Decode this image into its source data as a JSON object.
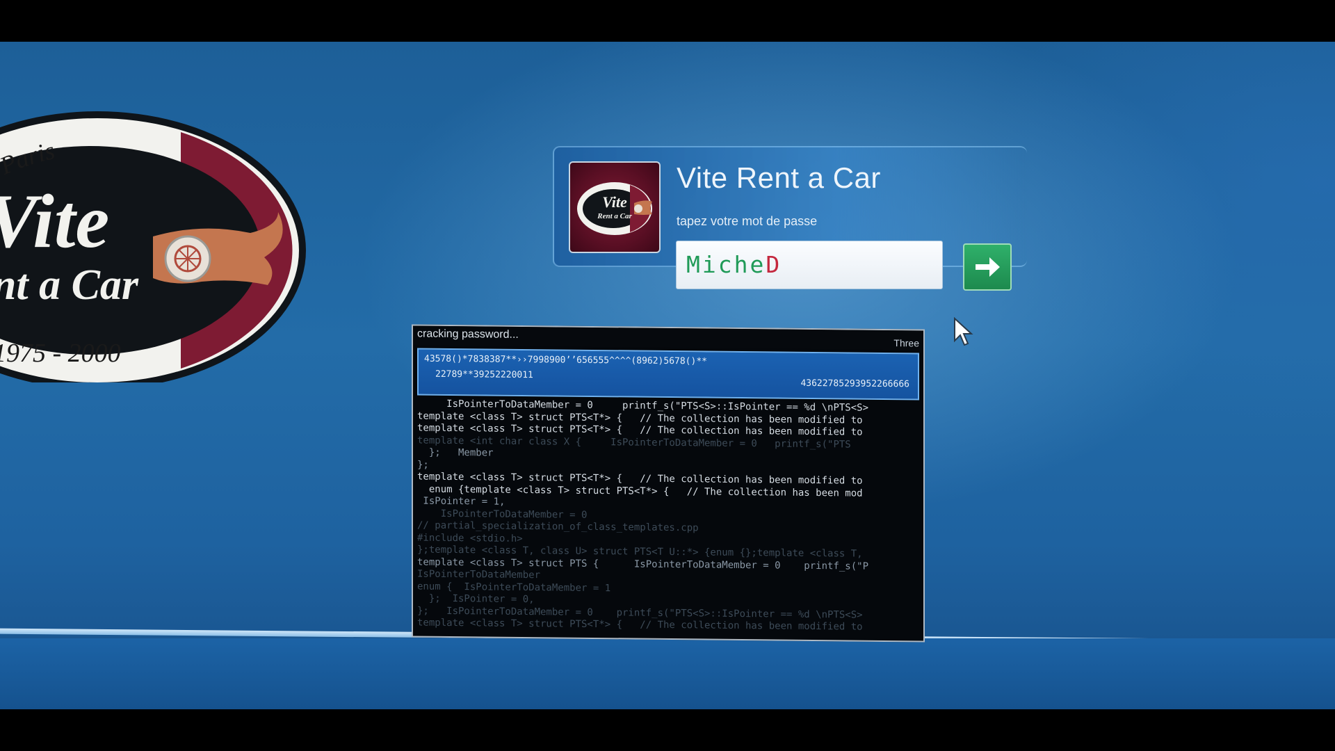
{
  "brand": {
    "name": "Vite Rent a Car",
    "big_logo": {
      "top_arc": "France - Paris",
      "word1": "Vite",
      "word2": "Rent a Car",
      "years": "1975 - 2000"
    },
    "small_logo": {
      "word1": "Vite",
      "word2": "Rent a Car"
    }
  },
  "login": {
    "title": "Vite Rent a Car",
    "prompt": "tapez votre mot de passe",
    "password_value_confirmed": "Miche",
    "password_value_current_char": "D",
    "submit_icon": "arrow-right-icon"
  },
  "cracker": {
    "title": "cracking password...",
    "mode": "Three",
    "output_line1": "43578()*7838387**››7998900’’656555^^^^(8962)5678()**",
    "output_line2": "22789**39252220011",
    "output_line3": "43622785293952266666",
    "code_lines": [
      {
        "text": "     IsPointerToDataMember = 0     printf_s(\"PTS<S>::IsPointer == %d \\nPTS<S>",
        "style": "bright"
      },
      {
        "text": "template <class T> struct PTS<T*> {   // The collection has been modified to",
        "style": "bright"
      },
      {
        "text": "template <class T> struct PTS<T*> {   // The collection has been modified to",
        "style": "bright"
      },
      {
        "text": "template <int char class X {     IsPointerToDataMember = 0   printf_s(\"PTS",
        "style": "dim"
      },
      {
        "text": "  };   Member",
        "style": "mid"
      },
      {
        "text": "};",
        "style": "mid"
      },
      {
        "text": "template <class T> struct PTS<T*> {   // The collection has been modified to",
        "style": "bright"
      },
      {
        "text": "  enum {template <class T> struct PTS<T*> {   // The collection has been mod",
        "style": "bright"
      },
      {
        "text": " IsPointer = 1,",
        "style": "mid"
      },
      {
        "text": "    IsPointerToDataMember = 0",
        "style": "dim"
      },
      {
        "text": "// partial_specialization_of_class_templates.cpp",
        "style": "dim"
      },
      {
        "text": "#include <stdio.h>",
        "style": "dim"
      },
      {
        "text": "};template <class T, class U> struct PTS<T U::*> {enum {};template <class T,",
        "style": "dim"
      },
      {
        "text": "template <class T> struct PTS {      IsPointerToDataMember = 0    printf_s(\"P",
        "style": "mid"
      },
      {
        "text": "IsPointerToDataMember",
        "style": "dim"
      },
      {
        "text": "enum {  IsPointerToDataMember = 1",
        "style": "dim"
      },
      {
        "text": "  };  IsPointer = 0,",
        "style": "dim"
      },
      {
        "text": "};   IsPointerToDataMember = 0    printf_s(\"PTS<S>::IsPointer == %d \\nPTS<S>",
        "style": "dim"
      },
      {
        "text": "template <class T> struct PTS<T*> {   // The collection has been modified to",
        "style": "dim"
      }
    ]
  },
  "colors": {
    "screen_blue": "#236ca8",
    "logo_maroon": "#7e1b33",
    "password_green": "#1f9a57",
    "password_red": "#c4283e",
    "submit_green": "#2fb06a",
    "terminal_bg": "#05080c",
    "output_blue": "#1b62b2"
  }
}
